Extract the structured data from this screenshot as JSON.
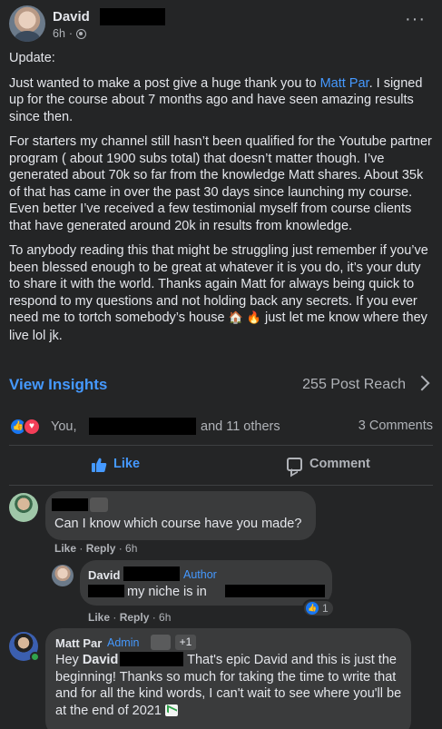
{
  "post": {
    "author": "David",
    "time": "6h",
    "update_label": "Update:",
    "para1_pre": "Just wanted to make a post give a huge thank you to ",
    "para1_link": "Matt Par",
    "para1_post": ". I signed up for the course about 7 months ago and have seen amazing results since then.",
    "para2": "For starters my channel still hasn’t been qualified for the Youtube partner program ( about 1900 subs total) that doesn’t matter though. I’ve generated about 70k so far from the knowledge Matt shares. About 35k of that has came in over the past 30 days since launching my course. Even better I’ve received a few testimonial myself from course clients that have generated around 20k in results from knowledge.",
    "para3_pre": "To anybody reading this that might be struggling just remember if you’ve been blessed enough to be great at whatever it is you do, it’s your duty to share it with the world. Thanks again Matt for always being quick to respond to my questions and not holding back any secrets. If you ever need me to tortch somebody’s house ",
    "para3_emoji1": "🏠",
    "para3_emoji2": "🔥",
    "para3_post": " just let me know where they live lol jk."
  },
  "insights": {
    "view_label": "View Insights",
    "reach": "255 Post Reach"
  },
  "reactions": {
    "you": "You,",
    "others": "and 11 others",
    "comments": "3 Comments"
  },
  "actions": {
    "like": "Like",
    "comment": "Comment"
  },
  "comments": [
    {
      "text": "Can I know which course have you made?",
      "like": "Like",
      "reply": "Reply",
      "time": "6h"
    },
    {
      "author": "David",
      "badge": "Author",
      "text": "my niche is in",
      "reaction_count": "1",
      "like": "Like",
      "reply": "Reply",
      "time": "6h"
    },
    {
      "author": "Matt Par",
      "badge": "Admin",
      "plus": "+1",
      "hey": "Hey",
      "mention": "David",
      "text_after": " That's epic David and this is just the beginning! Thanks so much for taking the time to write that and for all the kind words, I can't wait to see where you'll be at the end of 2021"
    }
  ],
  "icons": {
    "privacy": "globe-icon",
    "more": "more-options-icon",
    "like": "thumbs-up-icon",
    "love": "heart-icon",
    "comment": "comment-bubble-icon",
    "chevron": "chevron-right-icon",
    "chart": "chart-increasing-icon"
  },
  "colors": {
    "background": "#242526",
    "bubble": "#3a3b3c",
    "accent": "#4599ff",
    "text": "#e4e6eb",
    "muted": "#b0b3b8",
    "love": "#f33e58",
    "online": "#31a24c"
  }
}
